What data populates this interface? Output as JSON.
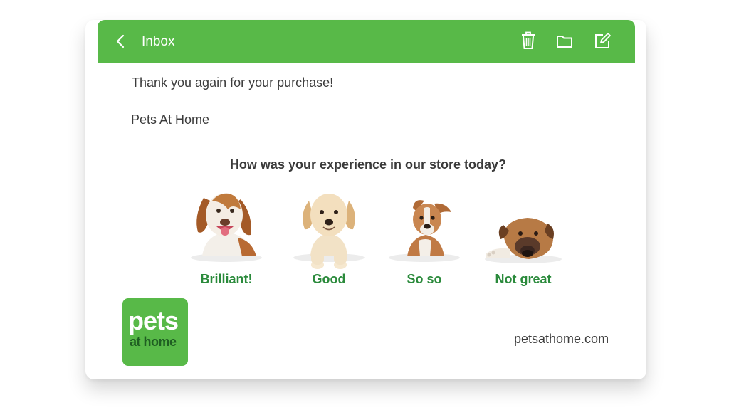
{
  "header": {
    "title": "Inbox",
    "icons": [
      "back-icon",
      "trash-icon",
      "folder-icon",
      "compose-icon"
    ],
    "color": "#58b948"
  },
  "email": {
    "line1": "Thank you again for your purchase!",
    "line2": "Pets At Home",
    "question": "How was your experience in our store today?",
    "options": [
      {
        "label": "Brilliant!",
        "icon": "happy-dog-image"
      },
      {
        "label": "Good",
        "icon": "puppy-image"
      },
      {
        "label": "So so",
        "icon": "terrier-dog-image"
      },
      {
        "label": "Not great",
        "icon": "sad-dog-image"
      }
    ]
  },
  "logo": {
    "line1": "pets",
    "line2": "at home",
    "color": "#58b948"
  },
  "footer": {
    "website": "petsathome.com"
  },
  "colors": {
    "accent": "#58b948",
    "label_green": "#2a8a3b",
    "text": "#3c3c3c"
  }
}
